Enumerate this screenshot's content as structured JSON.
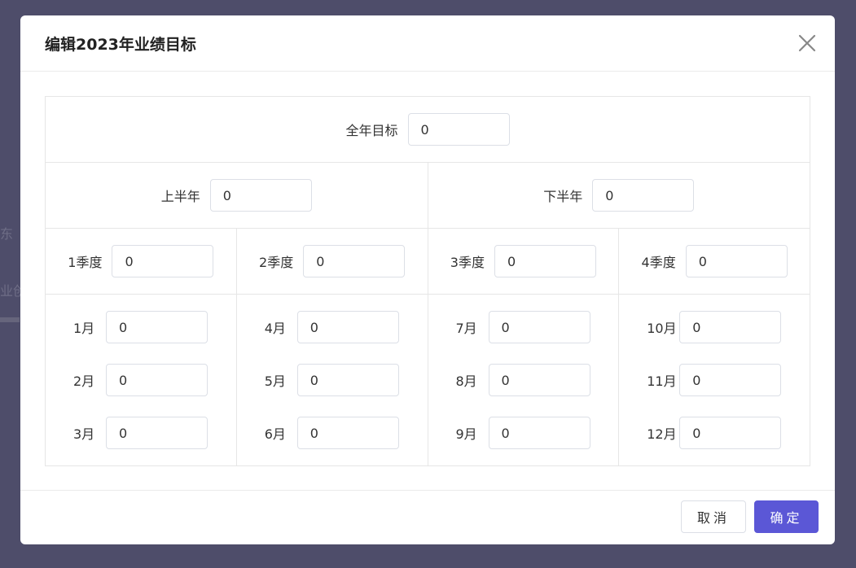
{
  "background": {
    "text_1": "东",
    "text_2": "业创"
  },
  "dialog": {
    "title": "编辑2023年业绩目标",
    "close_icon": "close-icon",
    "full_year": {
      "label": "全年目标",
      "value": "0"
    },
    "half_years": [
      {
        "label": "上半年",
        "value": "0"
      },
      {
        "label": "下半年",
        "value": "0"
      }
    ],
    "quarters": [
      {
        "label": "1季度",
        "value": "0"
      },
      {
        "label": "2季度",
        "value": "0"
      },
      {
        "label": "3季度",
        "value": "0"
      },
      {
        "label": "4季度",
        "value": "0"
      }
    ],
    "months": [
      {
        "label": "1月",
        "value": "0"
      },
      {
        "label": "2月",
        "value": "0"
      },
      {
        "label": "3月",
        "value": "0"
      },
      {
        "label": "4月",
        "value": "0"
      },
      {
        "label": "5月",
        "value": "0"
      },
      {
        "label": "6月",
        "value": "0"
      },
      {
        "label": "7月",
        "value": "0"
      },
      {
        "label": "8月",
        "value": "0"
      },
      {
        "label": "9月",
        "value": "0"
      },
      {
        "label": "10月",
        "value": "0"
      },
      {
        "label": "11月",
        "value": "0"
      },
      {
        "label": "12月",
        "value": "0"
      }
    ],
    "cancel_label": "取消",
    "ok_label": "确定",
    "accent_color": "#5b57d6"
  }
}
